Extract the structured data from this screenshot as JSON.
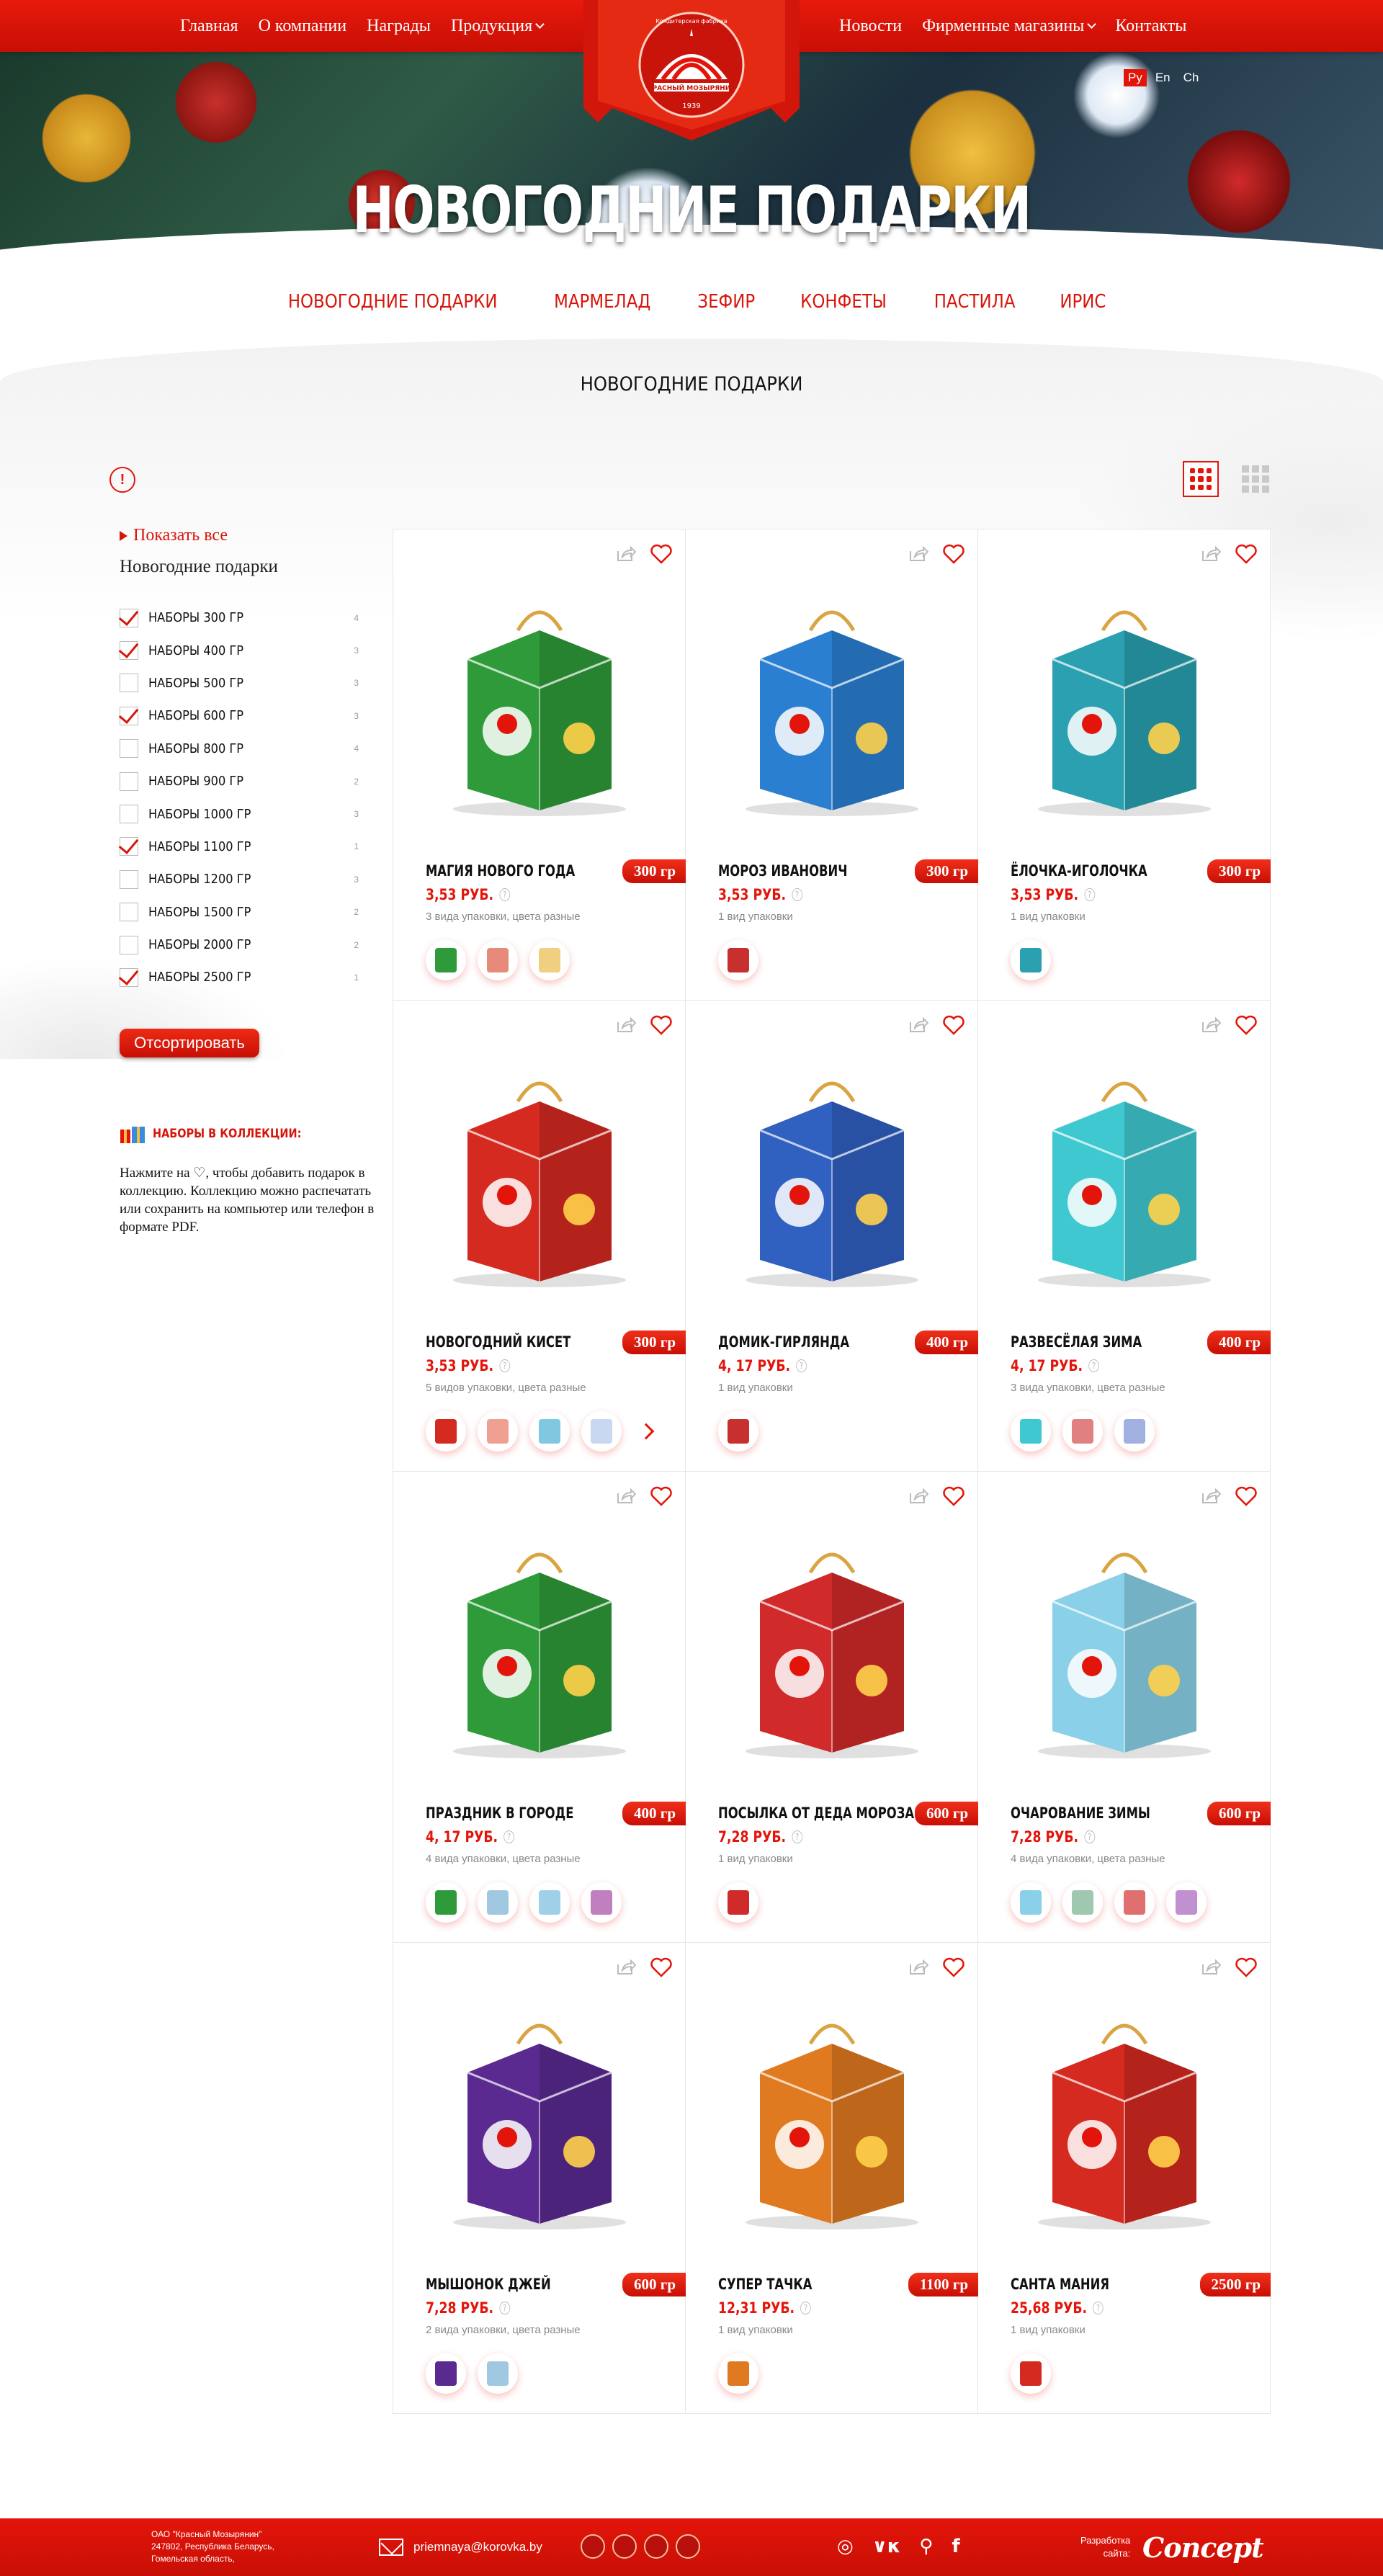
{
  "nav": {
    "left": [
      {
        "label": "Главная",
        "dropdown": false
      },
      {
        "label": "О компании",
        "dropdown": false
      },
      {
        "label": "Награды",
        "dropdown": false
      },
      {
        "label": "Продукция",
        "dropdown": true
      }
    ],
    "right": [
      {
        "label": "Новости",
        "dropdown": false
      },
      {
        "label": "Фирменные магазины",
        "dropdown": true
      },
      {
        "label": "Контакты",
        "dropdown": false
      }
    ]
  },
  "logo": {
    "top_text": "Кондитерская фабрика",
    "name": "КРАСНЫЙ МОЗЫРЯНИН",
    "year": "1939"
  },
  "languages": [
    {
      "label": "Ру",
      "active": true
    },
    {
      "label": "En",
      "active": false
    },
    {
      "label": "Ch",
      "active": false
    }
  ],
  "banner": {
    "title": "НОВОГОДНИЕ ПОДАРКИ"
  },
  "categories": [
    "НОВОГОДНИЕ ПОДАРКИ",
    "МАРМЕЛАД",
    "ЗЕФИР",
    "КОНФЕТЫ",
    "ПАСТИЛА",
    "ИРИС"
  ],
  "section_title": "НОВОГОДНИЕ ПОДАРКИ",
  "sidebar": {
    "show_all": "Показать все",
    "category": "Новогодние подарки",
    "filters": [
      {
        "label": "НАБОРЫ 300 ГР",
        "count": "4",
        "checked": true
      },
      {
        "label": "НАБОРЫ 400 ГР",
        "count": "3",
        "checked": true
      },
      {
        "label": "НАБОРЫ 500 ГР",
        "count": "3",
        "checked": false
      },
      {
        "label": "НАБОРЫ 600 ГР",
        "count": "3",
        "checked": true
      },
      {
        "label": "НАБОРЫ 800 ГР",
        "count": "4",
        "checked": false
      },
      {
        "label": "НАБОРЫ 900 ГР",
        "count": "2",
        "checked": false
      },
      {
        "label": "НАБОРЫ 1000 ГР",
        "count": "3",
        "checked": false
      },
      {
        "label": "НАБОРЫ 1100 ГР",
        "count": "1",
        "checked": true
      },
      {
        "label": "НАБОРЫ 1200 ГР",
        "count": "3",
        "checked": false
      },
      {
        "label": "НАБОРЫ 1500 ГР",
        "count": "2",
        "checked": false
      },
      {
        "label": "НАБОРЫ 2000 ГР",
        "count": "2",
        "checked": false
      },
      {
        "label": "НАБОРЫ 2500 ГР",
        "count": "1",
        "checked": true
      }
    ],
    "sort_button": "Отсортировать",
    "collection_title": "НАБОРЫ В КОЛЛЕКЦИИ:",
    "collection_text": "Нажмите на ♡, чтобы добавить подарок в коллекцию. Коллекцию можно распечатать или сохранить на компьютер или телефон в формате PDF."
  },
  "colors": {
    "brand": "#e3150a",
    "dark_brand": "#c80f05"
  },
  "products": [
    {
      "name": "МАГИЯ НОВОГО ГОДА",
      "weight": "300 гр",
      "price": "3,53 РУБ.",
      "variants": "3 вида упаковки, цвета разные",
      "image_color": "#2f9a3a",
      "thumbs": [
        "#2f9a3a",
        "#e88a7a",
        "#f0d080"
      ],
      "more": false
    },
    {
      "name": "МОРОЗ ИВАНОВИЧ",
      "weight": "300 гр",
      "price": "3,53 РУБ.",
      "variants": "1 вид упаковки",
      "image_color": "#2a7fd0",
      "thumbs": [
        "#c83030"
      ],
      "more": false
    },
    {
      "name": "ЁЛОЧКА-ИГОЛОЧКА",
      "weight": "300 гр",
      "price": "3,53 РУБ.",
      "variants": "1 вид упаковки",
      "image_color": "#2aa0b0",
      "thumbs": [
        "#2aa0b0"
      ],
      "more": false
    },
    {
      "name": "НОВОГОДНИЙ КИСЕТ",
      "weight": "300 гр",
      "price": "3,53 РУБ.",
      "variants": "5 видов упаковки, цвета разные",
      "image_color": "#d42a20",
      "thumbs": [
        "#d42a20",
        "#f0a090",
        "#80c8e0",
        "#c8d8f0"
      ],
      "more": true
    },
    {
      "name": "ДОМИК-ГИРЛЯНДА",
      "weight": "400 гр",
      "price": "4, 17 РУБ.",
      "variants": "1 вид упаковки",
      "image_color": "#3060c0",
      "thumbs": [
        "#c83030"
      ],
      "more": false
    },
    {
      "name": "РАЗВЕСЁЛАЯ ЗИМА",
      "weight": "400 гр",
      "price": "4, 17 РУБ.",
      "variants": "3 вида упаковки, цвета разные",
      "image_color": "#40c8d0",
      "thumbs": [
        "#40c8d0",
        "#e08080",
        "#a0b0e0"
      ],
      "more": false
    },
    {
      "name": "ПРАЗДНИК В ГОРОДЕ",
      "weight": "400 гр",
      "price": "4, 17 РУБ.",
      "variants": "4 вида упаковки, цвета разные",
      "image_color": "#2f9a3a",
      "thumbs": [
        "#2f9a3a",
        "#a0c8e0",
        "#a0d0e8",
        "#c080c0"
      ],
      "more": false
    },
    {
      "name": "ПОСЫЛКА ОТ ДЕДА МОРОЗА",
      "weight": "600 гр",
      "price": "7,28 РУБ.",
      "variants": "1 вид упаковки",
      "image_color": "#d02a2a",
      "thumbs": [
        "#d02a2a"
      ],
      "more": false
    },
    {
      "name": "ОЧАРОВАНИЕ ЗИМЫ",
      "weight": "600 гр",
      "price": "7,28 РУБ.",
      "variants": "4 вида упаковки, цвета разные",
      "image_color": "#8ad0e8",
      "thumbs": [
        "#8ad0e8",
        "#a0c8b0",
        "#e07070",
        "#c090d0"
      ],
      "more": false
    },
    {
      "name": "МЫШОНОК ДЖЕЙ",
      "weight": "600 гр",
      "price": "7,28 РУБ.",
      "variants": "2 вида упаковки, цвета разные",
      "image_color": "#5a2a90",
      "thumbs": [
        "#5a2a90",
        "#a0c8e0"
      ],
      "more": false
    },
    {
      "name": "СУПЕР ТАЧКА",
      "weight": "1100 гр",
      "price": "12,31 РУБ.",
      "variants": "1 вид упаковки",
      "image_color": "#e07a20",
      "thumbs": [
        "#e07a20"
      ],
      "more": false
    },
    {
      "name": "САНТА МАНИЯ",
      "weight": "2500 гр",
      "price": "25,68 РУБ.",
      "variants": "1 вид упаковки",
      "image_color": "#d42a20",
      "thumbs": [
        "#d42a20"
      ],
      "more": false
    }
  ],
  "footer": {
    "address": [
      "ОАО \"Красный Мозырянин\"",
      "247802, Республика Беларусь,",
      "Гомельская область,"
    ],
    "email": "priemnaya@korovka.by",
    "social": [
      "instagram-icon",
      "vk-icon",
      "odnoklassniki-icon",
      "facebook-icon"
    ],
    "dev_label_1": "Разработка",
    "dev_label_2": "сайта:",
    "dev_name": "Concept"
  }
}
